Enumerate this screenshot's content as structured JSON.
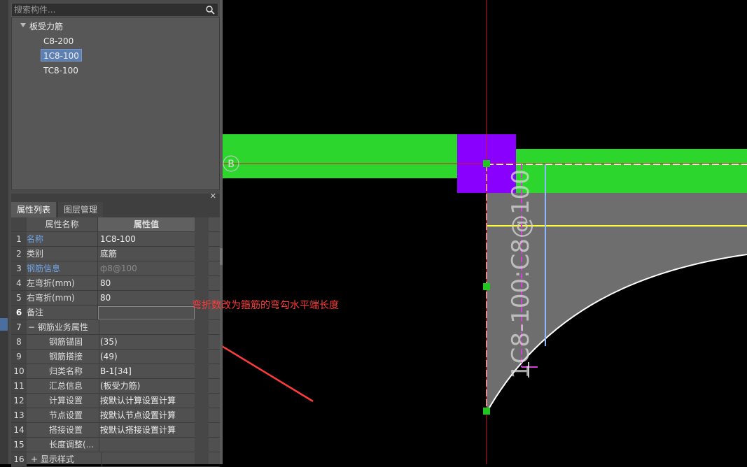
{
  "search": {
    "placeholder": "搜索构件..."
  },
  "tree": {
    "root": "板受力筋",
    "children": [
      "C8-200",
      "1C8-100",
      "TC8-100"
    ],
    "selected": "1C8-100"
  },
  "properties": {
    "tabs": [
      "属性列表",
      "图层管理"
    ],
    "active_tab": "属性列表",
    "col_name": "属性名称",
    "col_value": "属性值",
    "rows": [
      {
        "num": "1",
        "name": "名称",
        "value": "1C8-100"
      },
      {
        "num": "2",
        "name": "类别",
        "value": "底筋"
      },
      {
        "num": "3",
        "name": "钢筋信息",
        "value": "ф8@100"
      },
      {
        "num": "4",
        "name": "左弯折(mm)",
        "value": "80"
      },
      {
        "num": "5",
        "name": "右弯折(mm)",
        "value": "80"
      },
      {
        "num": "6",
        "name": "备注",
        "value": ""
      },
      {
        "num": "7",
        "name": "− 钢筋业务属性",
        "value": ""
      },
      {
        "num": "8",
        "name": "钢筋锚固",
        "value": "(35)"
      },
      {
        "num": "9",
        "name": "钢筋搭接",
        "value": "(49)"
      },
      {
        "num": "10",
        "name": "归类名称",
        "value": "B-1[34]"
      },
      {
        "num": "11",
        "name": "汇总信息",
        "value": "(板受力筋)"
      },
      {
        "num": "12",
        "name": "计算设置",
        "value": "按默认计算设置计算"
      },
      {
        "num": "13",
        "name": "节点设置",
        "value": "按默认节点设置计算"
      },
      {
        "num": "14",
        "name": "搭接设置",
        "value": "按默认搭接设置计算"
      },
      {
        "num": "15",
        "name": "长度调整(...",
        "value": ""
      },
      {
        "num": "16",
        "name": "+ 显示样式",
        "value": ""
      }
    ]
  },
  "canvas": {
    "axis_label": "B",
    "rebar_label": "1C8-100:C8@100",
    "annotation": "弯折数改为箍筋的弯勾水平端长度",
    "colors": {
      "beam": "#2cd62c",
      "column": "#8a00ff",
      "slab": "#6e6e6e",
      "axis": "#c81e1e",
      "annotation": "#ff3b3b",
      "rebar_line": "#d63cd6",
      "yellow_line": "#ffff33",
      "blue_line": "#8fb8ff"
    }
  }
}
